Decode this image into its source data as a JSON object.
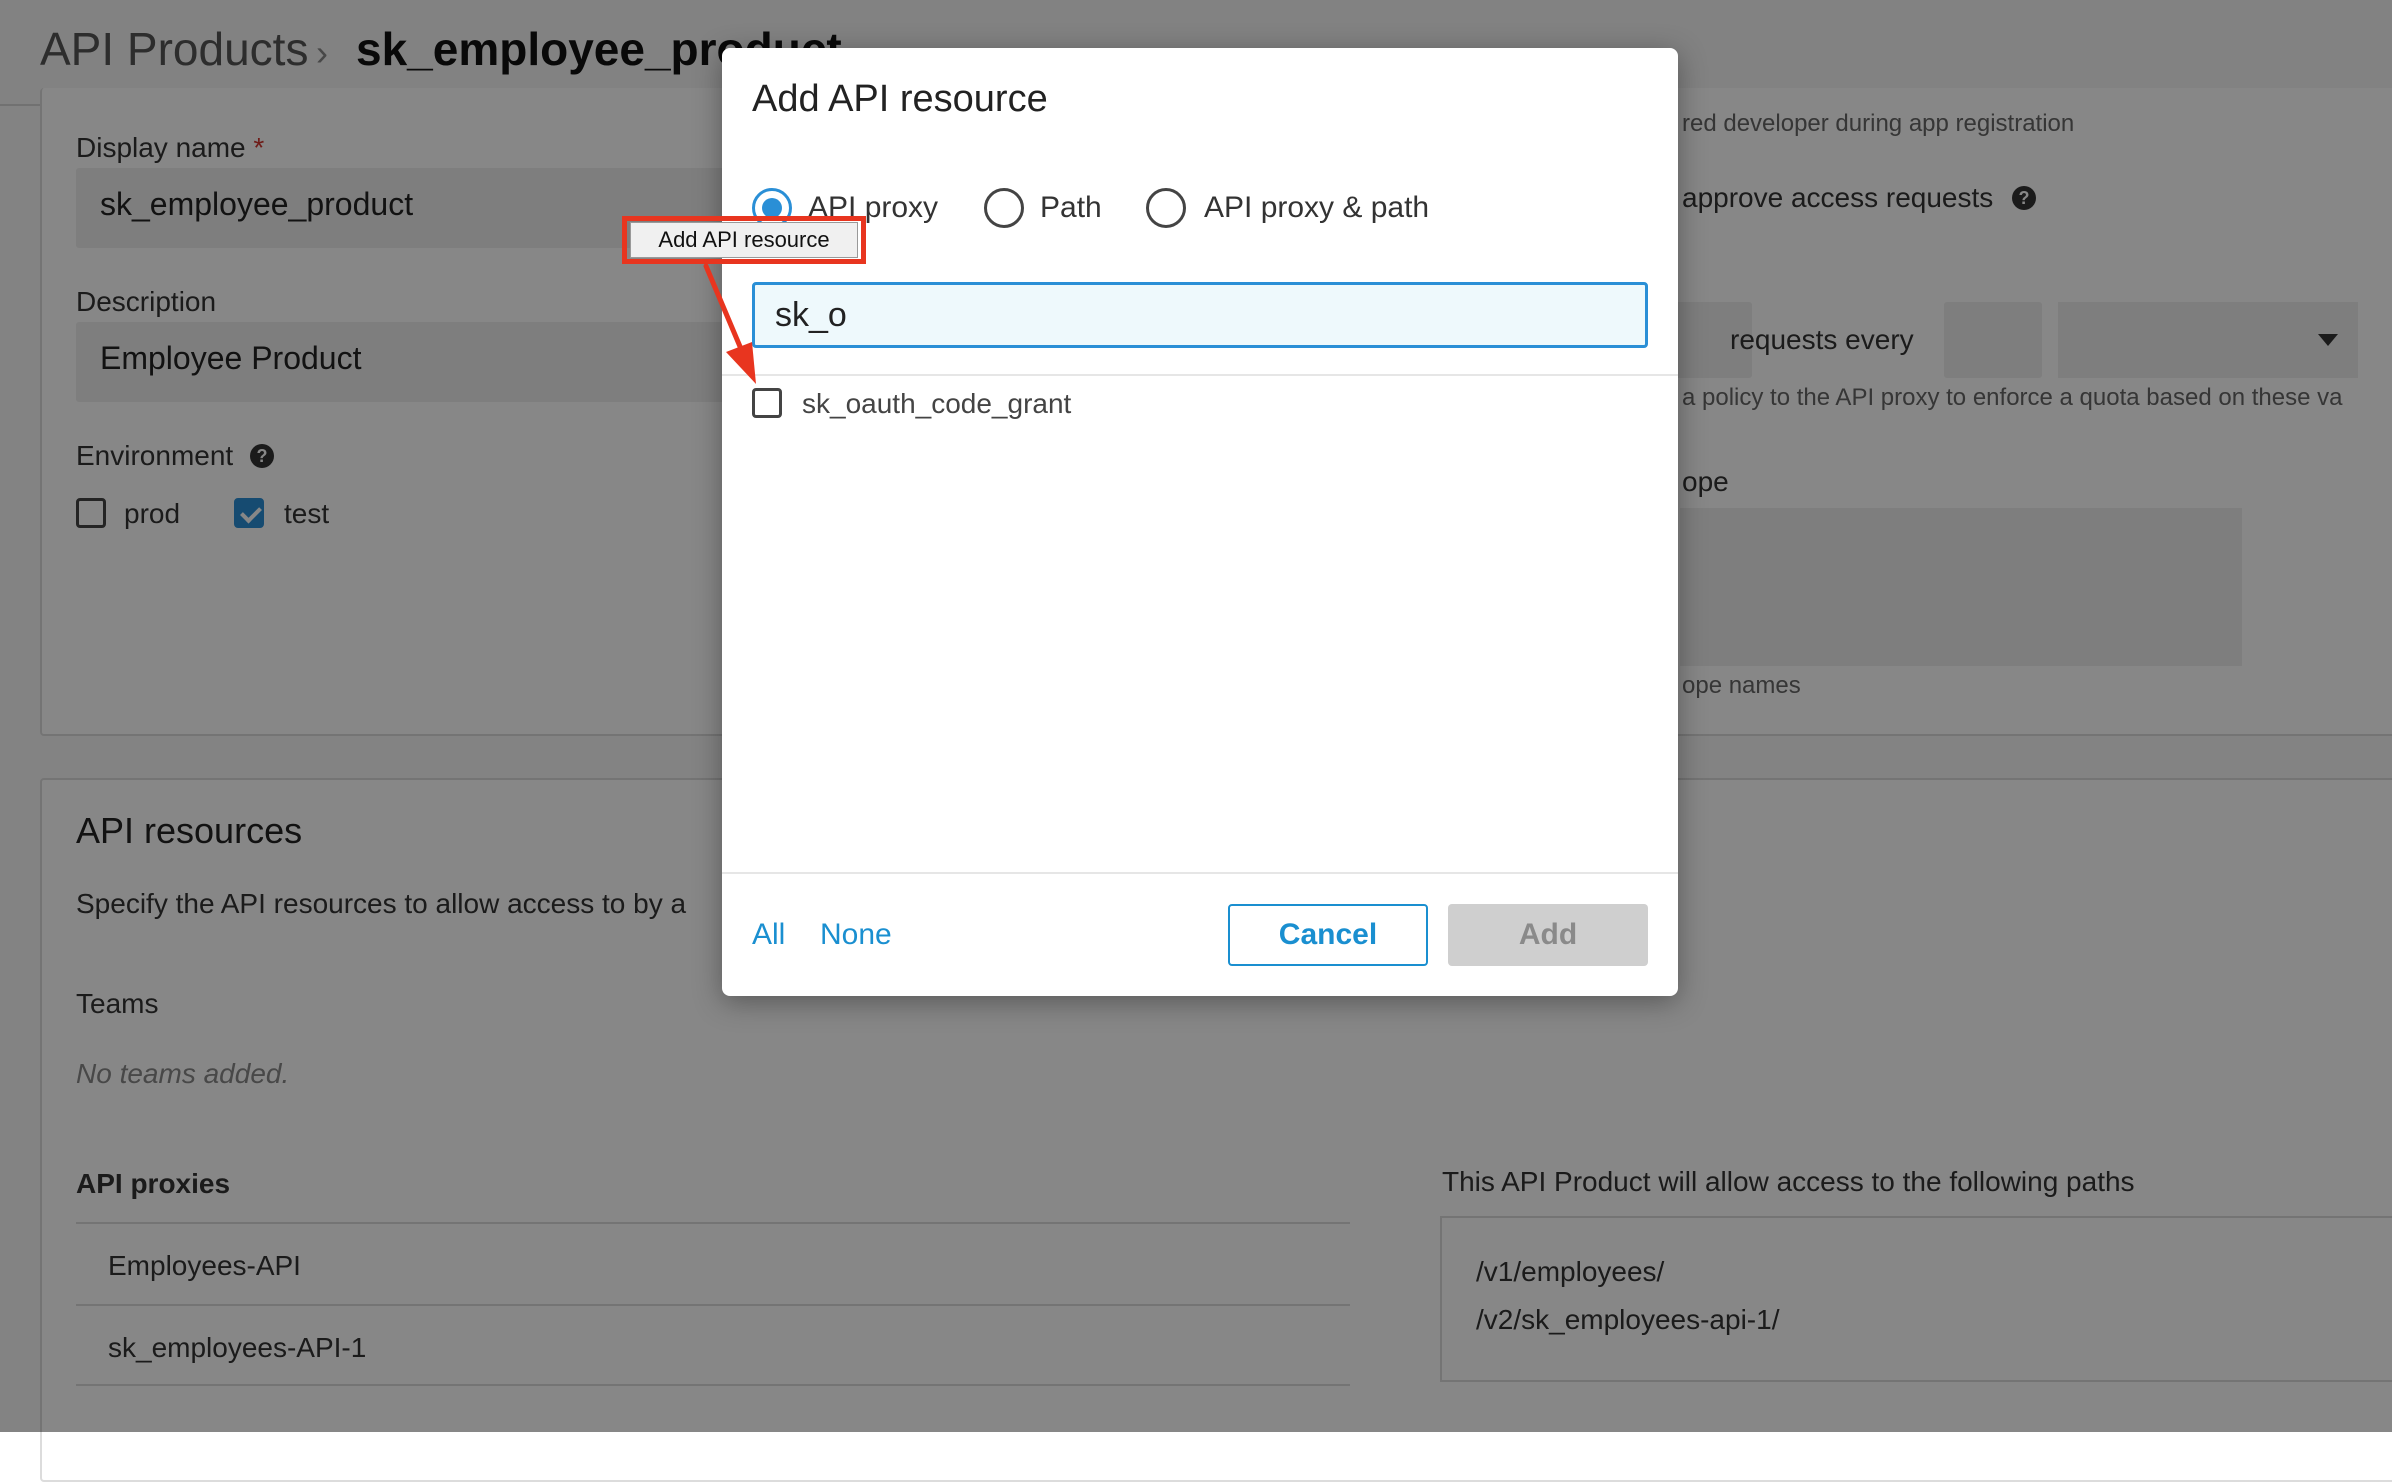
{
  "breadcrumb": {
    "root": "API Products",
    "separator": "›",
    "current": "sk_employee_product"
  },
  "form": {
    "display_name_label": "Display name",
    "required_mark": "*",
    "display_name_value": "sk_employee_product",
    "description_label": "Description",
    "description_value": "Employee Product",
    "environment_label": "Environment",
    "env_options": [
      {
        "label": "prod",
        "checked": false
      },
      {
        "label": "test",
        "checked": true
      }
    ],
    "right_fragments": {
      "registration_hint": "red developer during app registration",
      "approve_label": "approve access requests",
      "requests_every": "requests every",
      "quota_hint": "a policy to the API proxy to enforce a quota based on these va",
      "scope_label": "ope",
      "scope_hint": "ope names"
    }
  },
  "resources": {
    "title": "API resources",
    "description": "Specify the API resources to allow access to by a",
    "teams_label": "Teams",
    "teams_empty": "No teams added.",
    "proxies_label": "API proxies",
    "proxies": [
      "Employees-API",
      "sk_employees-API-1"
    ],
    "paths_label": "This API Product will allow access to the following paths",
    "paths": [
      "/v1/employees/",
      "/v2/sk_employees-api-1/"
    ]
  },
  "modal": {
    "title": "Add API resource",
    "radios": [
      {
        "label": "API proxy",
        "selected": true
      },
      {
        "label": "Path",
        "selected": false
      },
      {
        "label": "API proxy & path",
        "selected": false
      }
    ],
    "search_value": "sk_o",
    "results": [
      {
        "label": "sk_oauth_code_grant",
        "checked": false
      }
    ],
    "all_label": "All",
    "none_label": "None",
    "cancel_label": "Cancel",
    "add_label": "Add"
  },
  "annotation": {
    "tooltip_text": "Add API resource",
    "color": "#e8351f"
  },
  "colors": {
    "accent": "#2a8fd6",
    "link": "#1a8fd0",
    "overlay": "rgba(0,0,0,0.47)"
  }
}
